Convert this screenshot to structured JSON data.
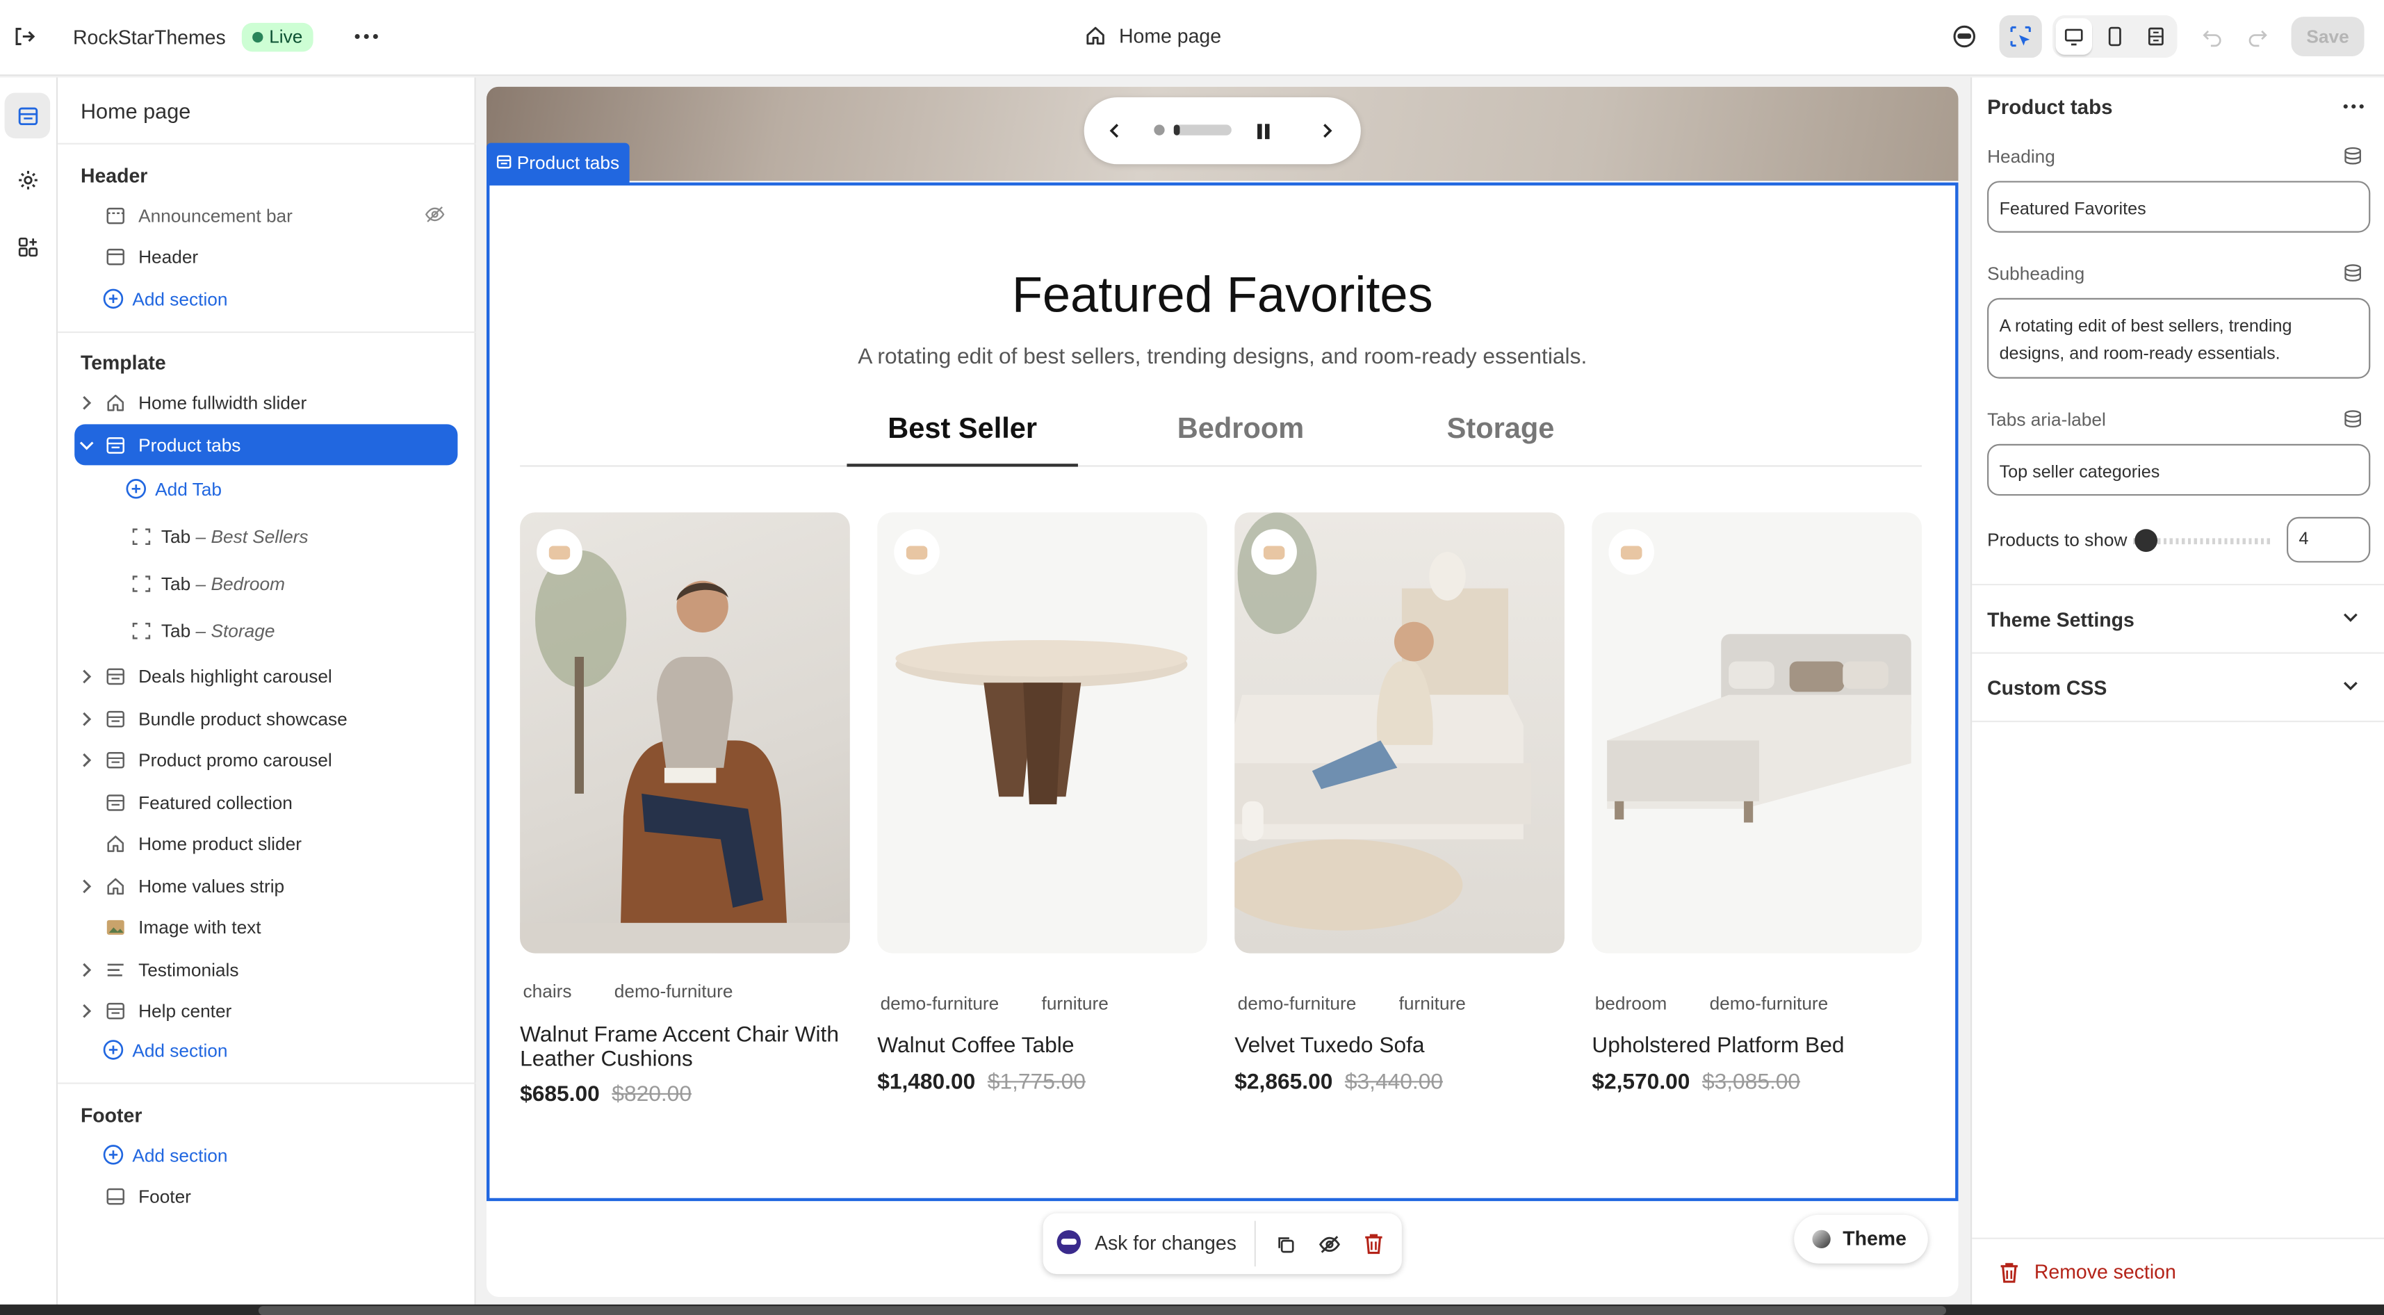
{
  "topbar": {
    "store_name": "RockStarThemes",
    "live_label": "Live",
    "page_label": "Home page",
    "save_label": "Save"
  },
  "left_panel": {
    "title": "Home page",
    "header_group": {
      "title": "Header",
      "items": [
        "Announcement bar",
        "Header"
      ],
      "add_label": "Add section"
    },
    "template_group": {
      "title": "Template",
      "items": [
        "Home fullwidth slider",
        "Product tabs",
        "Deals highlight carousel",
        "Bundle product showcase",
        "Product promo carousel",
        "Featured collection",
        "Home product slider",
        "Home values strip",
        "Image with text",
        "Testimonials",
        "Help center"
      ],
      "add_tab_label": "Add Tab",
      "tab_prefix": "Tab",
      "tab_sep": "–",
      "tabs": [
        "Best Sellers",
        "Bedroom",
        "Storage"
      ],
      "add_label": "Add section"
    },
    "footer_group": {
      "title": "Footer",
      "add_label": "Add section",
      "items": [
        "Footer"
      ]
    }
  },
  "canvas": {
    "section_tag": "Product tabs",
    "heading": "Featured Favorites",
    "subheading": "A rotating edit of best sellers, trending designs, and room-ready essentials.",
    "tabs": [
      "Best Seller",
      "Bedroom",
      "Storage"
    ],
    "products": [
      {
        "tags": [
          "chairs",
          "demo-furniture"
        ],
        "name": "Walnut Frame Accent Chair With Leather Cushions",
        "price": "$685.00",
        "compare": "$820.00"
      },
      {
        "tags": [
          "demo-furniture",
          "furniture"
        ],
        "name": "Walnut Coffee Table",
        "price": "$1,480.00",
        "compare": "$1,775.00"
      },
      {
        "tags": [
          "demo-furniture",
          "furniture"
        ],
        "name": "Velvet Tuxedo Sofa",
        "price": "$2,865.00",
        "compare": "$3,440.00"
      },
      {
        "tags": [
          "bedroom",
          "demo-furniture"
        ],
        "name": "Upholstered Platform Bed",
        "price": "$2,570.00",
        "compare": "$3,085.00"
      }
    ],
    "ask_label": "Ask for changes",
    "theme_label": "Theme"
  },
  "right_panel": {
    "title": "Product tabs",
    "heading_label": "Heading",
    "heading_value": "Featured Favorites",
    "subheading_label": "Subheading",
    "subheading_value": "A rotating edit of best sellers, trending designs, and room-ready essentials.",
    "aria_label": "Tabs aria-label",
    "aria_value": "Top seller categories",
    "products_label": "Products to show",
    "products_value": "4",
    "products_slider_fraction": 0.0,
    "theme_settings": "Theme Settings",
    "custom_css": "Custom CSS",
    "remove_label": "Remove section"
  },
  "colors": {
    "accent": "#2167e0",
    "live_bg": "#cdfed4",
    "live_dot": "#29845a",
    "danger": "#b42318"
  }
}
